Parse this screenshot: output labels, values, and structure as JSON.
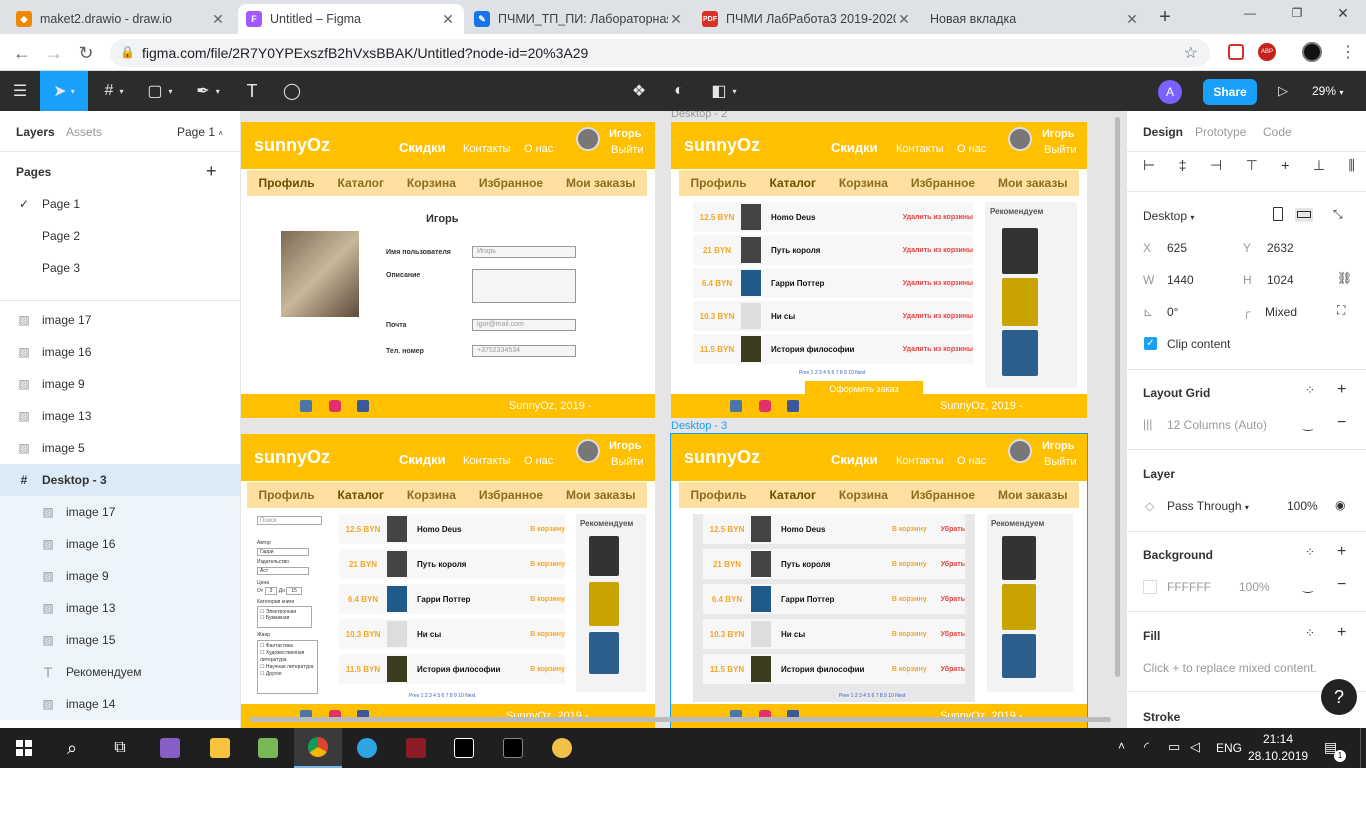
{
  "browser": {
    "tabs": [
      {
        "title": "maket2.drawio - draw.io",
        "active": false,
        "icon": "drawio-icon",
        "color": "#f08705"
      },
      {
        "title": "Untitled – Figma",
        "active": true,
        "icon": "figma-icon",
        "color": "#a259ff"
      },
      {
        "title": "ПЧМИ_ТП_ПИ: Лабораторная",
        "active": false,
        "icon": "moodle-icon",
        "color": "#1a73e8"
      },
      {
        "title": "ПЧМИ ЛабРабота3 2019-2020",
        "active": false,
        "icon": "pdf-icon",
        "color": "#d93025"
      },
      {
        "title": "Новая вкладка",
        "active": false,
        "icon": "",
        "color": "#dee1e6"
      }
    ],
    "url": "figma.com/file/2R7Y0YPExszfB2hVxsBBAK/Untitled?node-id=20%3A29"
  },
  "figma": {
    "avatar": "A",
    "share": "Share",
    "zoom": "29%",
    "left": {
      "tabs": [
        "Layers",
        "Assets"
      ],
      "page_selector": "Page 1",
      "pages_title": "Pages",
      "pages": [
        "Page 1",
        "Page 2",
        "Page 3"
      ],
      "layers": [
        {
          "name": "image 17",
          "kind": "image",
          "indent": 0
        },
        {
          "name": "image 16",
          "kind": "image",
          "indent": 0
        },
        {
          "name": "image 9",
          "kind": "image",
          "indent": 0
        },
        {
          "name": "image 13",
          "kind": "image",
          "indent": 0
        },
        {
          "name": "image 5",
          "kind": "image",
          "indent": 0
        },
        {
          "name": "Desktop - 3",
          "kind": "frame",
          "indent": 0
        },
        {
          "name": "image 17",
          "kind": "image",
          "indent": 1
        },
        {
          "name": "image 16",
          "kind": "image",
          "indent": 1
        },
        {
          "name": "image 9",
          "kind": "image",
          "indent": 1
        },
        {
          "name": "image 13",
          "kind": "image",
          "indent": 1
        },
        {
          "name": "image 15",
          "kind": "image",
          "indent": 1
        },
        {
          "name": "Рекомендуем",
          "kind": "text",
          "indent": 1
        },
        {
          "name": "image 14",
          "kind": "image",
          "indent": 1
        }
      ]
    },
    "right": {
      "tabs": [
        "Design",
        "Prototype",
        "Code"
      ],
      "frame_type": "Desktop",
      "x": "625",
      "y": "2632",
      "w": "1440",
      "h": "1024",
      "rotation": "0°",
      "radius": "Mixed",
      "clip": "Clip content",
      "layout_grid": "Layout Grid",
      "grid_value": "12 Columns (Auto)",
      "layer_title": "Layer",
      "blend": "Pass Through",
      "opacity": "100%",
      "background_title": "Background",
      "bg_hex": "FFFFFF",
      "bg_op": "100%",
      "fill_title": "Fill",
      "fill_hint": "Click + to replace mixed content.",
      "stroke_title": "Stroke",
      "help": "?"
    },
    "canvas": {
      "frame_labels": [
        "Desktop - 2",
        "Desktop - 3"
      ],
      "site": {
        "logo": "sunnyOz",
        "nav": [
          "Скидки",
          "Контакты",
          "О нас"
        ],
        "user": "Игорь",
        "logout": "Выйти",
        "menu": [
          "Профиль",
          "Каталог",
          "Корзина",
          "Избранное",
          "Мои заказы"
        ],
        "footer": "SunnyOz, 2019 -",
        "profile": {
          "name": "Игорь",
          "fields": [
            {
              "label": "Имя пользователя",
              "value": "Игорь"
            },
            {
              "label": "Описание",
              "value": ""
            },
            {
              "label": "Почта",
              "value": "igor@mail.com"
            },
            {
              "label": "Тел. номер",
              "value": "+3752334534"
            }
          ]
        },
        "books": [
          {
            "price": "12.5 BYN",
            "title": "Homo Deus"
          },
          {
            "price": "21 BYN",
            "title": "Путь короля"
          },
          {
            "price": "6.4 BYN",
            "title": "Гарри Поттер"
          },
          {
            "price": "10.3 BYN",
            "title": "Ни сы"
          },
          {
            "price": "11.5 BYN",
            "title": "История философии"
          }
        ],
        "remove": "Удалить из корзины",
        "to_cart": "В корзину",
        "remove_short": "Убрать",
        "recommend": "Рекомендуем",
        "order": "Оформить заказ",
        "pager": "Prev 1 2 3 4 5 6 7 8 9 10 Next",
        "search": "Поиск",
        "filters": {
          "author": "Автор",
          "author_val": "Гарри",
          "publisher": "Издательство",
          "publisher_val": "Аст",
          "price": "Цена",
          "from": "От",
          "from_val": "3",
          "to": "До",
          "to_val": "15",
          "book_cat": "Категория книги",
          "cats": [
            "Электронная",
            "Бумажная"
          ],
          "genre": "Жанр",
          "genres": [
            "Фантастика",
            "Художественная литература",
            "Научная литература",
            "Другое"
          ]
        }
      }
    }
  },
  "taskbar": {
    "lang": "ENG",
    "time": "21:14",
    "date": "28.10.2019",
    "notif": "1"
  }
}
